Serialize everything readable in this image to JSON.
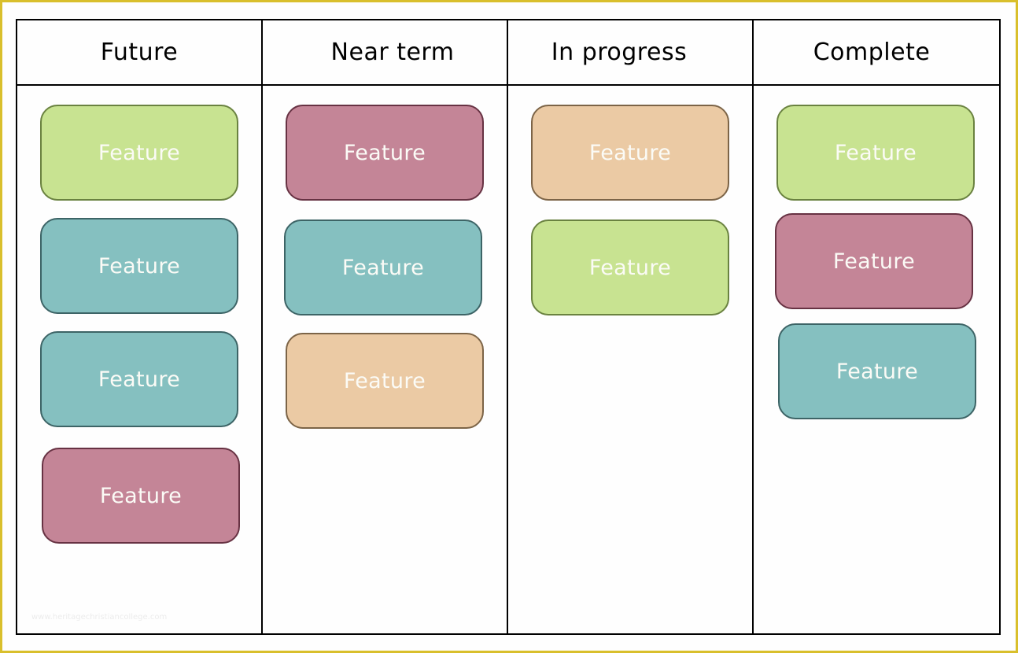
{
  "board": {
    "columns": [
      {
        "title": "Future",
        "cards": [
          {
            "label": "Feature",
            "color": "green"
          },
          {
            "label": "Feature",
            "color": "teal"
          },
          {
            "label": "Feature",
            "color": "teal"
          },
          {
            "label": "Feature",
            "color": "pink"
          }
        ]
      },
      {
        "title": "Near term",
        "cards": [
          {
            "label": "Feature",
            "color": "pink"
          },
          {
            "label": "Feature",
            "color": "teal"
          },
          {
            "label": "Feature",
            "color": "tan"
          }
        ]
      },
      {
        "title": "In progress",
        "cards": [
          {
            "label": "Feature",
            "color": "tan"
          },
          {
            "label": "Feature",
            "color": "green"
          }
        ]
      },
      {
        "title": "Complete",
        "cards": [
          {
            "label": "Feature",
            "color": "green"
          },
          {
            "label": "Feature",
            "color": "pink"
          },
          {
            "label": "Feature",
            "color": "teal"
          }
        ]
      }
    ]
  },
  "colors": {
    "green": "#c8e391",
    "teal": "#85c0c0",
    "pink": "#c48597",
    "tan": "#ebcaa4",
    "frame": "#d9bf2c"
  },
  "watermark": "www.heritagechristiancollege.com"
}
